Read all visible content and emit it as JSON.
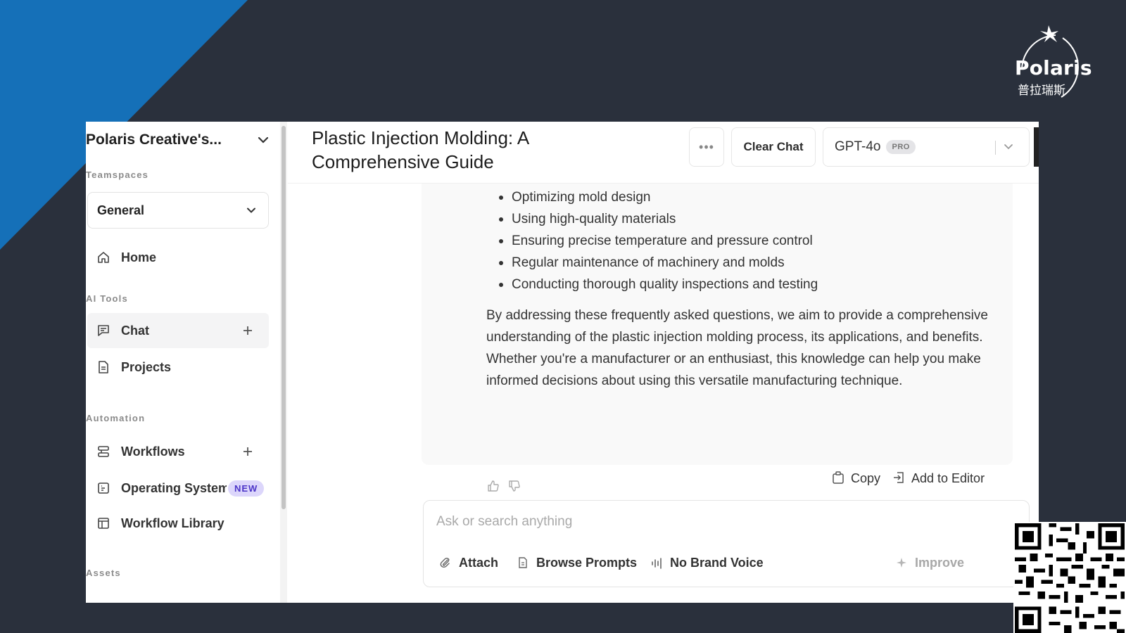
{
  "brand": {
    "name": "Polaris",
    "subtitle": "普拉瑞斯"
  },
  "sidebar": {
    "workspace_name": "Polaris Creative's...",
    "teamspaces_label": "Teamspaces",
    "teamspace_value": "General",
    "home_label": "Home",
    "ai_tools_label": "AI Tools",
    "chat_label": "Chat",
    "projects_label": "Projects",
    "automation_label": "Automation",
    "workflows_label": "Workflows",
    "operating_system_label": "Operating System",
    "new_badge": "NEW",
    "workflow_library_label": "Workflow Library",
    "assets_label": "Assets"
  },
  "header": {
    "title": "Plastic Injection Molding: A Comprehensive Guide",
    "more_label": "•••",
    "clear_chat_label": "Clear Chat",
    "model_name": "GPT-4o",
    "model_badge": "PRO"
  },
  "message": {
    "bullets": [
      "Optimizing mold design",
      "Using high-quality materials",
      "Ensuring precise temperature and pressure control",
      "Regular maintenance of machinery and molds",
      "Conducting thorough quality inspections and testing"
    ],
    "paragraph": "By addressing these frequently asked questions, we aim to provide a comprehensive understanding of the plastic injection molding process, its applications, and benefits. Whether you're a manufacturer or an enthusiast, this knowledge can help you make informed decisions about using this versatile manufacturing technique.",
    "copy_label": "Copy",
    "add_to_editor_label": "Add to Editor"
  },
  "composer": {
    "placeholder": "Ask or search anything",
    "attach_label": "Attach",
    "browse_prompts_label": "Browse Prompts",
    "brand_voice_label": "No Brand Voice",
    "improve_label": "Improve"
  },
  "colors": {
    "background": "#2a303c",
    "accent_blue": "#1570b8",
    "new_badge_bg": "#dcd6fb",
    "new_badge_text": "#4c35c8"
  }
}
